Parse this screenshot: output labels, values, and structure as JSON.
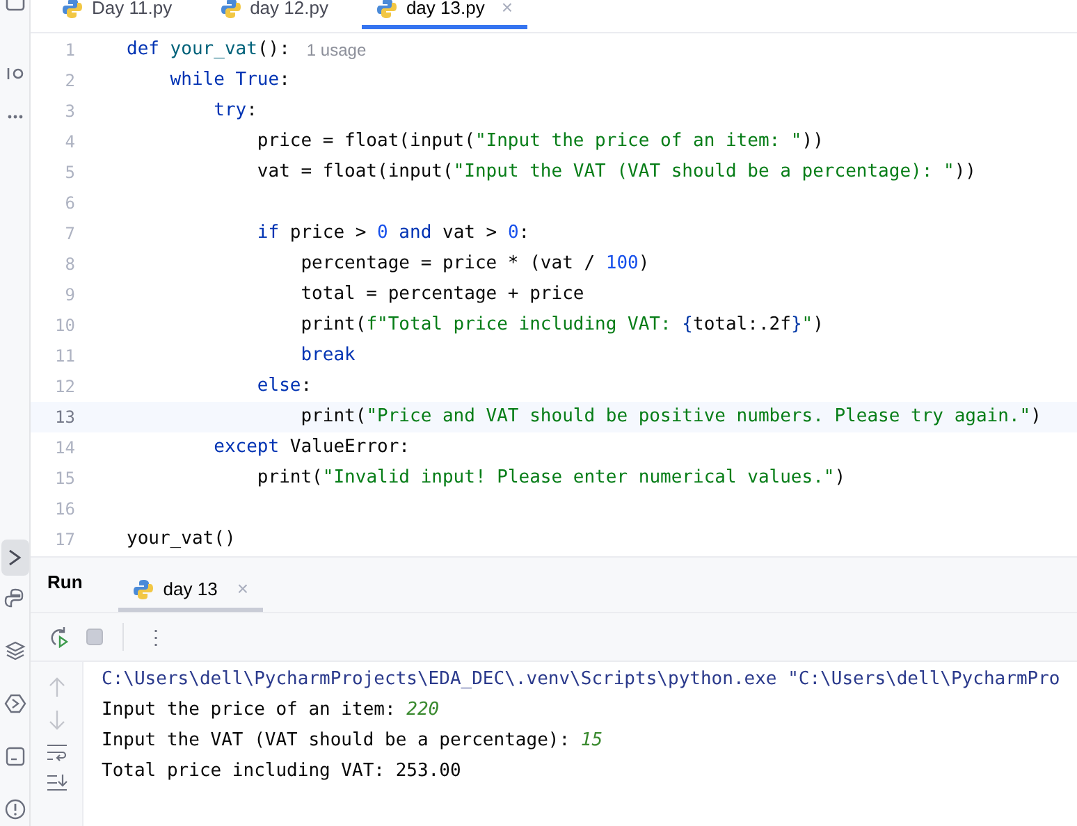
{
  "editor_tabs": [
    {
      "label": "Day 11.py",
      "selected": false
    },
    {
      "label": "day 12.py",
      "selected": false
    },
    {
      "label": "day 13.py",
      "selected": true,
      "close": "×"
    }
  ],
  "code_lines": [
    {
      "number": "1",
      "current": false,
      "hint": "1 usage",
      "tokens": [
        {
          "text": "def",
          "kind": "keyword"
        },
        {
          "text": " your_vat",
          "kind": "function"
        },
        {
          "text": "():",
          "kind": "plain"
        }
      ]
    },
    {
      "number": "2",
      "current": false,
      "tokens": [
        {
          "text": "    while",
          "kind": "keyword"
        },
        {
          "text": " True",
          "kind": "keyword"
        },
        {
          "text": ":",
          "kind": "plain"
        }
      ]
    },
    {
      "number": "3",
      "current": false,
      "tokens": [
        {
          "text": "        try",
          "kind": "keyword"
        },
        {
          "text": ":",
          "kind": "plain"
        }
      ]
    },
    {
      "number": "4",
      "current": false,
      "tokens": [
        {
          "text": "            price = float(input(",
          "kind": "plain"
        },
        {
          "text": "\"Input the price of an item: \"",
          "kind": "string"
        },
        {
          "text": "))",
          "kind": "plain"
        }
      ]
    },
    {
      "number": "5",
      "current": false,
      "tokens": [
        {
          "text": "            vat = float(input(",
          "kind": "plain"
        },
        {
          "text": "\"Input the VAT (VAT should be a percentage): \"",
          "kind": "string"
        },
        {
          "text": "))",
          "kind": "plain"
        }
      ]
    },
    {
      "number": "6",
      "current": false
    },
    {
      "number": "7",
      "current": false,
      "tokens": [
        {
          "text": "            if",
          "kind": "keyword"
        },
        {
          "text": " price > ",
          "kind": "plain"
        },
        {
          "text": "0",
          "kind": "number"
        },
        {
          "text": " and",
          "kind": "keyword"
        },
        {
          "text": " vat > ",
          "kind": "plain"
        },
        {
          "text": "0",
          "kind": "number"
        },
        {
          "text": ":",
          "kind": "plain"
        }
      ]
    },
    {
      "number": "8",
      "current": false,
      "tokens": [
        {
          "text": "                percentage = price * (vat / ",
          "kind": "plain"
        },
        {
          "text": "100",
          "kind": "number"
        },
        {
          "text": ")",
          "kind": "plain"
        }
      ]
    },
    {
      "number": "9",
      "current": false,
      "tokens": [
        {
          "text": "                total = percentage + price",
          "kind": "plain"
        }
      ]
    },
    {
      "number": "10",
      "current": false,
      "tokens": [
        {
          "text": "                print(",
          "kind": "plain"
        },
        {
          "text": "f\"Total price including VAT: ",
          "kind": "string"
        },
        {
          "text": "{",
          "kind": "brace"
        },
        {
          "text": "total:.2f",
          "kind": "plain"
        },
        {
          "text": "}",
          "kind": "brace"
        },
        {
          "text": "\"",
          "kind": "string"
        },
        {
          "text": ")",
          "kind": "plain"
        }
      ]
    },
    {
      "number": "11",
      "current": false,
      "tokens": [
        {
          "text": "                break",
          "kind": "keyword"
        }
      ]
    },
    {
      "number": "12",
      "current": false,
      "tokens": [
        {
          "text": "            else",
          "kind": "keyword"
        },
        {
          "text": ":",
          "kind": "plain"
        }
      ]
    },
    {
      "number": "13",
      "current": true,
      "tokens": [
        {
          "text": "                print(",
          "kind": "plain"
        },
        {
          "text": "\"Price and VAT should be positive numbers. Please try again.\"",
          "kind": "string"
        },
        {
          "text": ")",
          "kind": "plain"
        }
      ]
    },
    {
      "number": "14",
      "current": false,
      "tokens": [
        {
          "text": "        except",
          "kind": "keyword"
        },
        {
          "text": " ValueError:",
          "kind": "plain"
        }
      ]
    },
    {
      "number": "15",
      "current": false,
      "tokens": [
        {
          "text": "            print(",
          "kind": "plain"
        },
        {
          "text": "\"Invalid input! Please enter numerical values.\"",
          "kind": "string"
        },
        {
          "text": ")",
          "kind": "plain"
        }
      ]
    },
    {
      "number": "16",
      "current": false
    },
    {
      "number": "17",
      "current": false,
      "tokens": [
        {
          "text": "your_vat()",
          "kind": "plain"
        }
      ]
    }
  ],
  "run_panel": {
    "title": "Run",
    "tabs": [
      {
        "label": "day 13",
        "selected": true,
        "close": "×"
      }
    ],
    "more": "⋮",
    "console": [
      [
        {
          "text": "C:\\Users\\dell\\PycharmProjects\\EDA_DEC\\.venv\\Scripts\\python.exe \"C:\\Users\\dell\\PycharmPro",
          "kind": "command"
        }
      ],
      [
        {
          "text": "Input the price of an item: ",
          "kind": "output"
        },
        {
          "text": "220",
          "kind": "input"
        }
      ],
      [
        {
          "text": "Input the VAT (VAT should be a percentage): ",
          "kind": "output"
        },
        {
          "text": "15",
          "kind": "input"
        }
      ],
      [
        {
          "text": "Total price including VAT: 253.00",
          "kind": "output"
        }
      ]
    ]
  }
}
